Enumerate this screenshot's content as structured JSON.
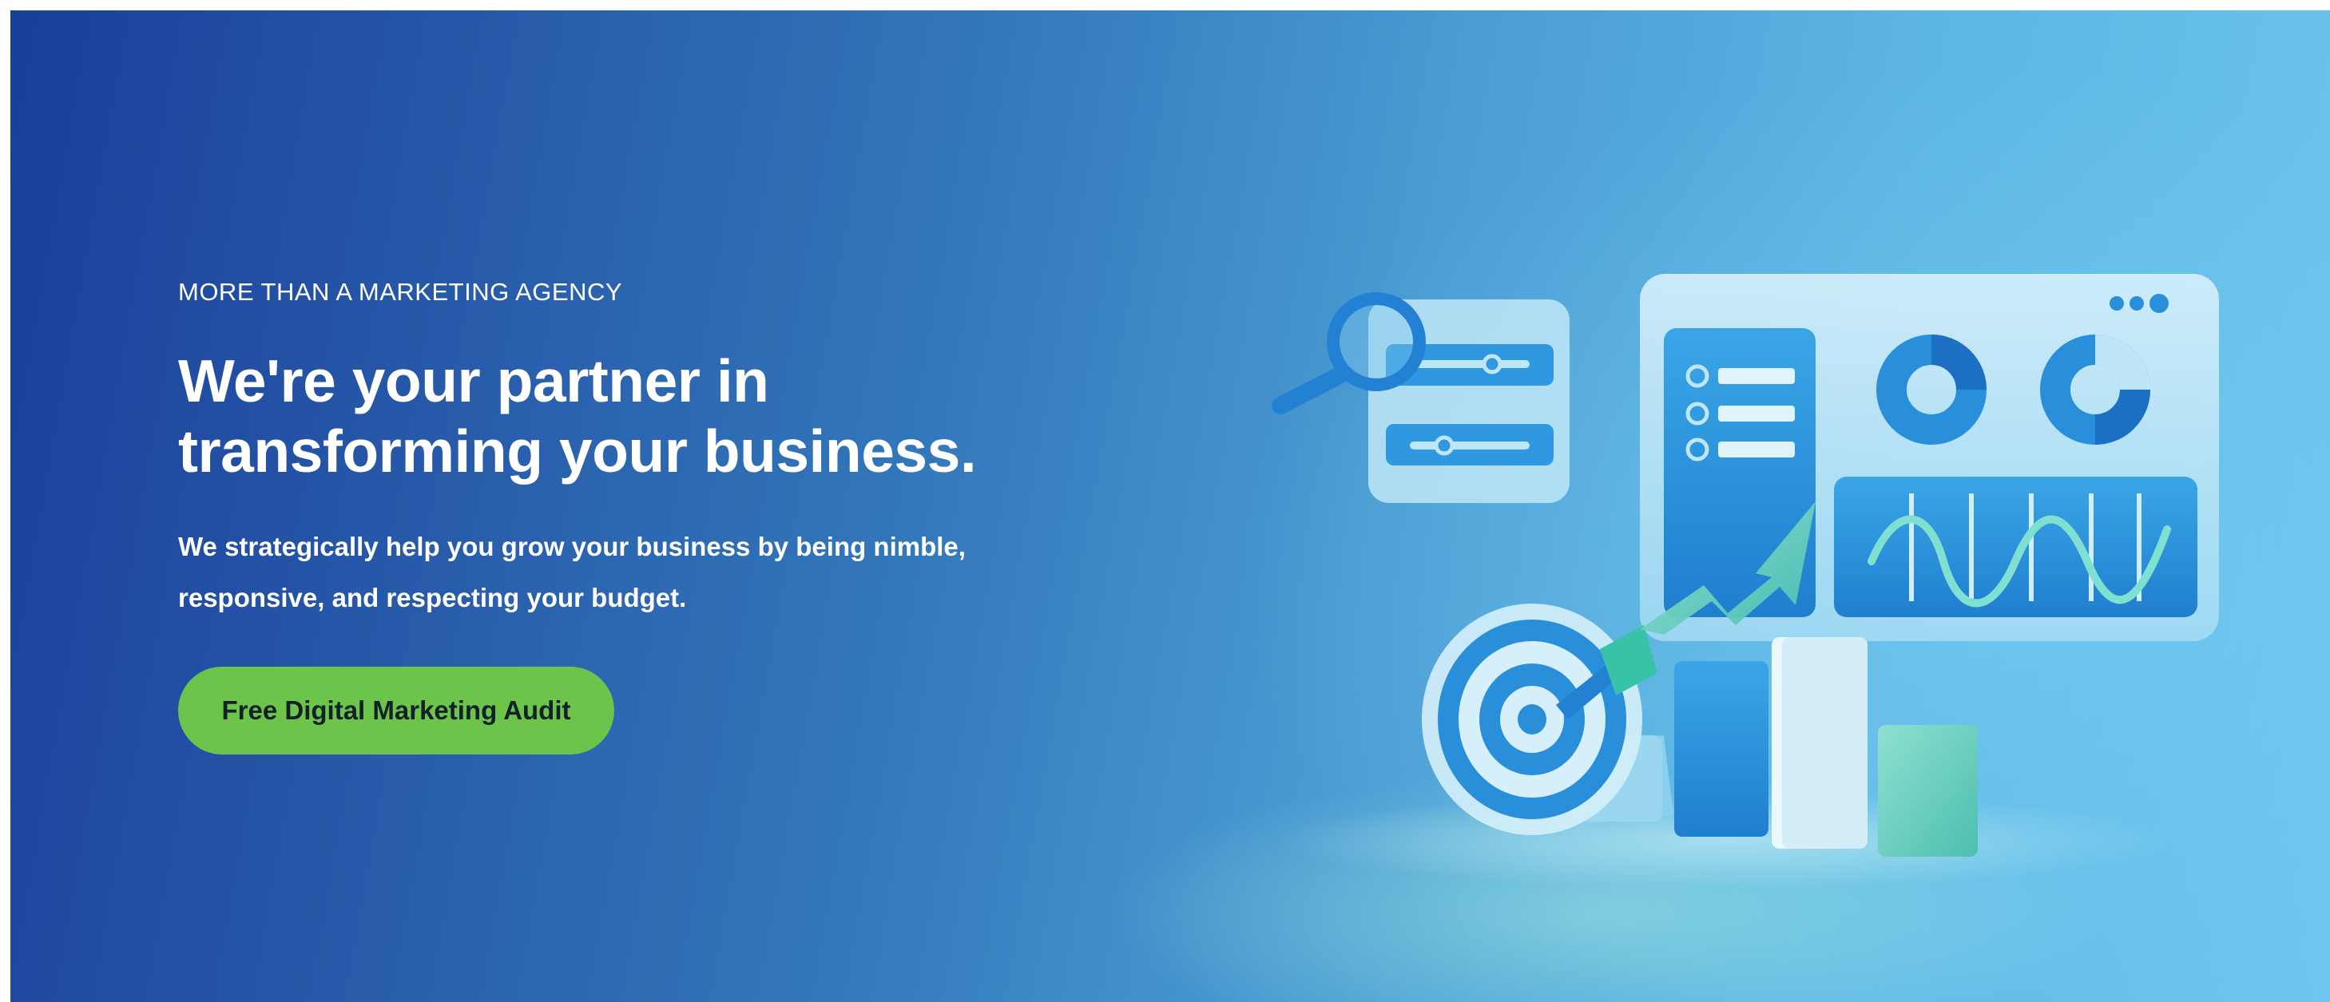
{
  "hero": {
    "eyebrow": "MORE THAN A MARKETING AGENCY",
    "headline_line1": "We're your partner in",
    "headline_line2": "transforming your business.",
    "sub_line1": "We strategically help you grow your business by being nimble,",
    "sub_line2": "responsive, and respecting your budget.",
    "cta_label": "Free Digital Marketing Audit"
  },
  "colors": {
    "gradient_start": "#1a3f9a",
    "gradient_end": "#6cc6ef",
    "cta_background": "#6cc44a",
    "cta_text": "#12202a",
    "text": "#ffffff"
  },
  "illustration": {
    "icons": [
      "magnifier-icon",
      "slider-icon",
      "list-icon",
      "donut-chart-icon",
      "pie-chart-icon",
      "wave-chart-icon",
      "target-icon",
      "arrow-up-icon",
      "bar-blocks-icon"
    ]
  }
}
